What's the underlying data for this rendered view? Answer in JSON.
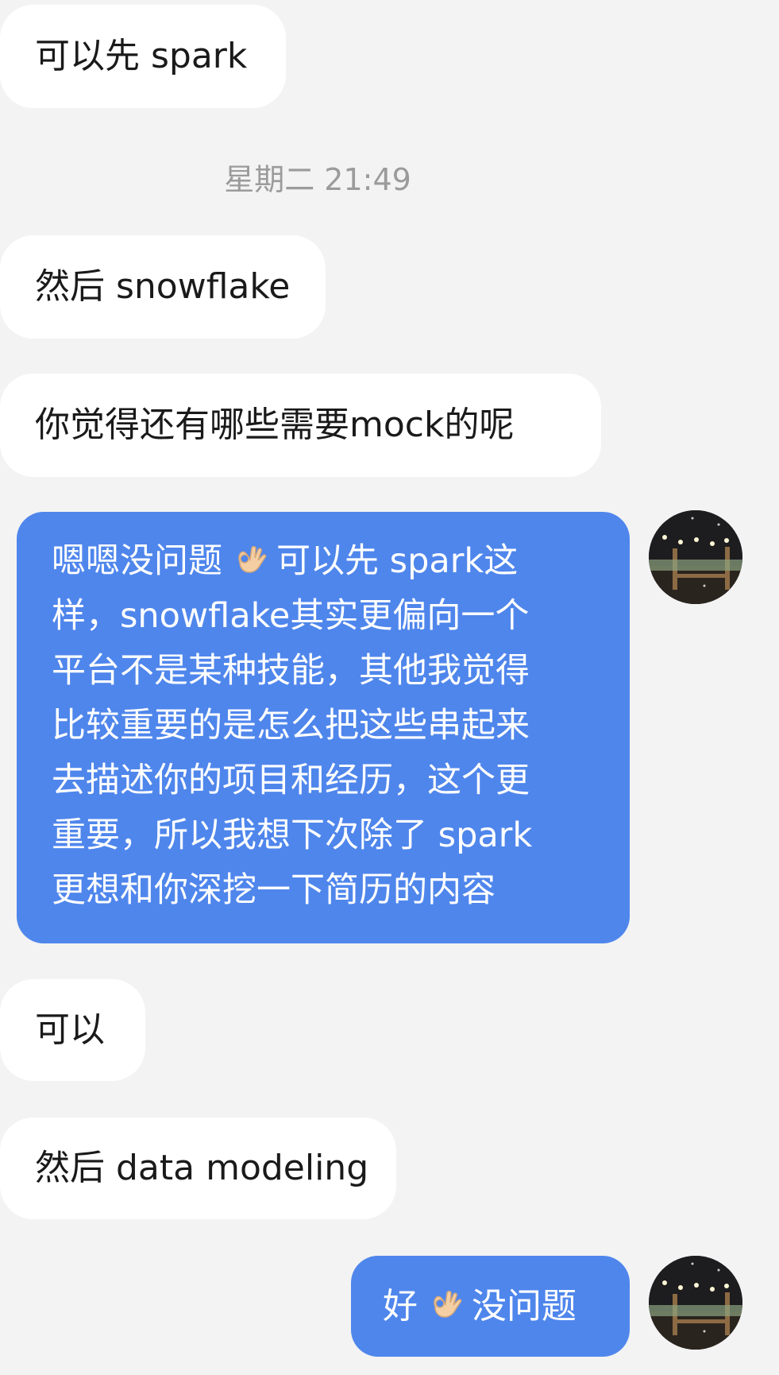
{
  "colors": {
    "background": "#f3f3f3",
    "incoming_bubble": "#ffffff",
    "outgoing_bubble": "#4f86ec",
    "timestamp_text": "#9b9b9b"
  },
  "messages": {
    "m1": "可以先 spark",
    "timestamp": "星期二 21:49",
    "m2": "然后 snowflake",
    "m3": "你觉得还有哪些需要mock的呢",
    "m4": {
      "line1_pre": "嗯嗯没问题",
      "line1_post": "可以先 spark这",
      "line2": "样，snowflake其实更偏向一个",
      "line3": "平台不是某种技能，其他我觉得",
      "line4": "比较重要的是怎么把这些串起来",
      "line5": "去描述你的项目和经历，这个更",
      "line6": "重要，所以我想下次除了 spark",
      "line7": "更想和你深挖一下简历的内容"
    },
    "m5": "可以",
    "m6": "然后 data modeling",
    "m7": {
      "pre": "好",
      "post": "没问题"
    }
  },
  "icons": {
    "ok_hand": "ok-hand-icon",
    "avatar": "avatar-image"
  }
}
